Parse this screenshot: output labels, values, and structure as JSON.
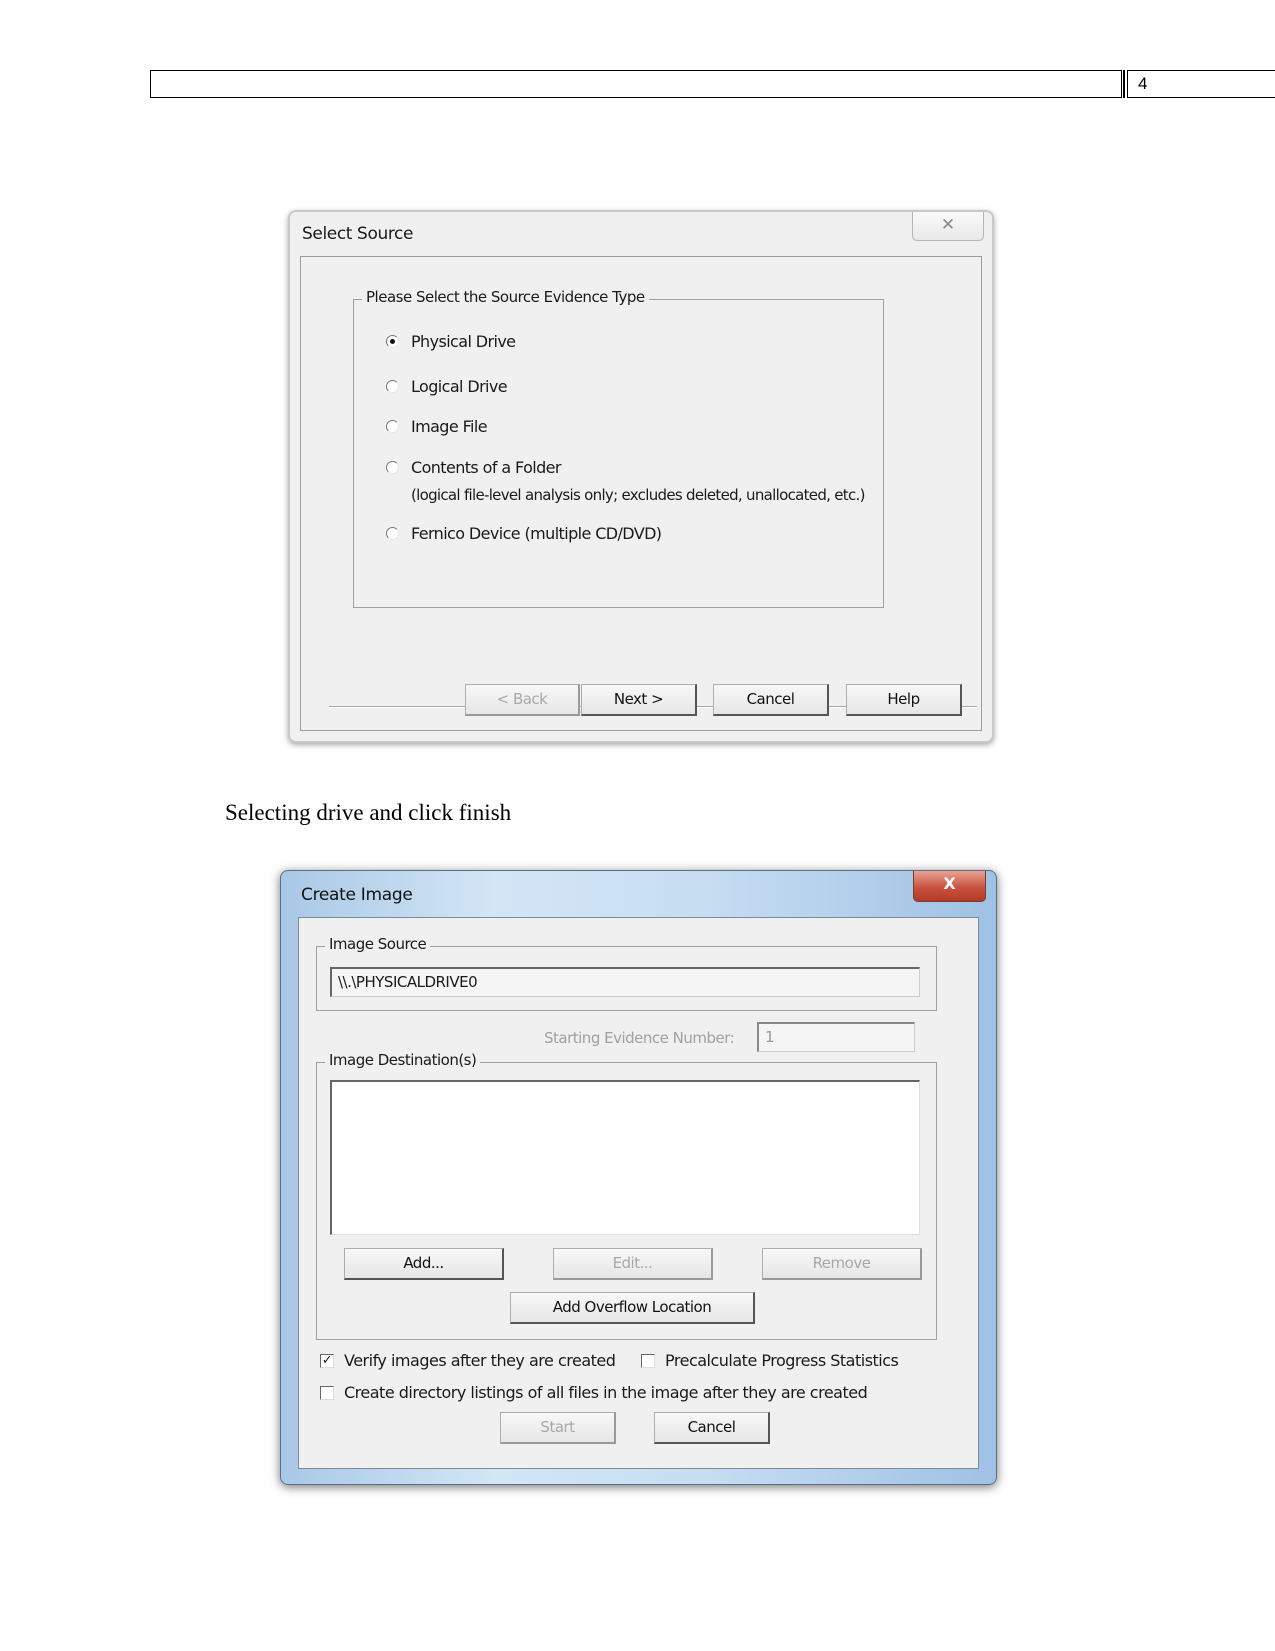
{
  "page": {
    "page_number": "4",
    "caption": "Selecting drive and click finish"
  },
  "select_source": {
    "title": "Select Source",
    "close_glyph": "✕",
    "group_label": "Please Select the Source Evidence Type",
    "options": [
      {
        "label": "Physical Drive",
        "selected": true
      },
      {
        "label": "Logical Drive",
        "selected": false
      },
      {
        "label": "Image File",
        "selected": false
      },
      {
        "label": "Contents of a Folder",
        "sublabel": "(logical file-level analysis only; excludes deleted, unallocated, etc.)",
        "selected": false
      },
      {
        "label": "Fernico Device (multiple CD/DVD)",
        "selected": false
      }
    ],
    "buttons": {
      "back": "< Back",
      "next": "Next >",
      "cancel": "Cancel",
      "help": "Help"
    }
  },
  "create_image": {
    "title": "Create Image",
    "close_glyph": "X",
    "image_source_label": "Image Source",
    "image_source_value": "\\\\.\\PHYSICALDRIVE0",
    "starting_evidence_label": "Starting Evidence Number:",
    "starting_evidence_value": "1",
    "destinations_label": "Image Destination(s)",
    "destinations": [],
    "buttons": {
      "add": "Add...",
      "edit": "Edit...",
      "remove": "Remove",
      "add_overflow": "Add Overflow Location",
      "start": "Start",
      "cancel": "Cancel"
    },
    "checkboxes": {
      "verify": {
        "label": "Verify images after they are created",
        "checked": true
      },
      "precalculate": {
        "label": "Precalculate Progress Statistics",
        "checked": false
      },
      "directory_listings": {
        "label": "Create directory listings of all files in the image after they are created",
        "checked": false
      }
    }
  }
}
